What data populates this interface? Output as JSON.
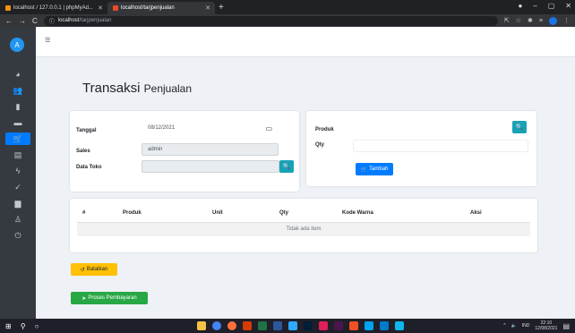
{
  "browser": {
    "tabs": [
      {
        "label": "localhost / 127.0.0.1 | phpMyAd...",
        "active": false,
        "fav_color": "#f29111"
      },
      {
        "label": "localhost/tarjpenjualan",
        "active": true,
        "fav_color": "#e44d26"
      }
    ],
    "new_tab": "+",
    "url_host": "localhost",
    "url_path": "/tarjpenjualan",
    "url_info_icon": "ⓘ"
  },
  "sidebar": {
    "avatar_letter": "A",
    "icons": [
      "dashboard-icon",
      "users-icon",
      "box-icon",
      "list-icon",
      "cart-icon",
      "receipt-icon",
      "bolt-icon",
      "check-icon",
      "report-icon",
      "user-icon",
      "power-icon"
    ]
  },
  "page": {
    "title": "Transaksi",
    "title_sub": "Penjualan"
  },
  "form_left": {
    "tanggal_label": "Tanggal",
    "tanggal_value": "08/12/2021",
    "sales_label": "Sales",
    "sales_value": "admin",
    "datatoko_label": "Data Toko",
    "datatoko_value": ""
  },
  "form_right": {
    "produk_label": "Produk",
    "produk_value": "",
    "qty_label": "Qty",
    "qty_value": "",
    "tambah_label": "Tambah"
  },
  "table": {
    "headers": [
      "#",
      "Produk",
      "Unit",
      "Qty",
      "Kode Warna",
      "Aksi"
    ],
    "empty_text": "Tidak ada item"
  },
  "actions": {
    "batalkan_label": "Batalkan",
    "proses_label": "Proses Pembayaran"
  },
  "taskbar": {
    "lang": "IND",
    "time": "22:10",
    "date": "12/08/2021"
  },
  "colors": {
    "primary": "#007bff",
    "info": "#17a2b8",
    "warning": "#ffc107",
    "success": "#28a745",
    "sidebar": "#343a40"
  }
}
